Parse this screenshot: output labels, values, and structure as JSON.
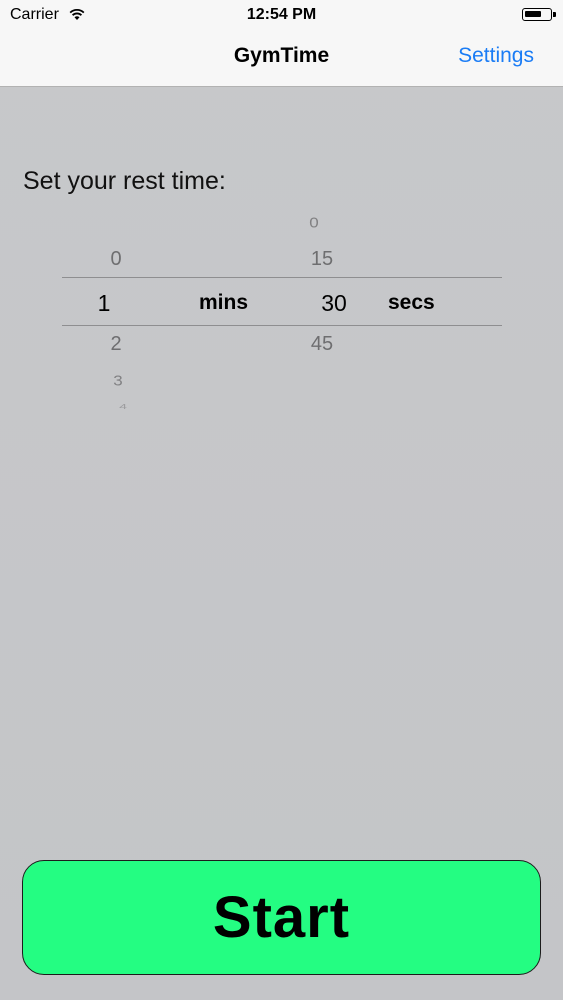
{
  "status_bar": {
    "carrier": "Carrier",
    "time": "12:54 PM"
  },
  "nav": {
    "title": "GymTime",
    "settings_label": "Settings"
  },
  "prompt": "Set your rest time:",
  "picker": {
    "minutes": {
      "values": [
        "0",
        "1",
        "2",
        "3",
        "4"
      ],
      "selected": "1",
      "unit": "mins"
    },
    "seconds": {
      "values": [
        "0",
        "15",
        "30",
        "45"
      ],
      "selected": "30",
      "unit": "secs"
    }
  },
  "start_button": {
    "label": "Start",
    "color": "#24fd82"
  },
  "colors": {
    "accent": "#1a7cf5",
    "background": "#c6c7c9"
  }
}
